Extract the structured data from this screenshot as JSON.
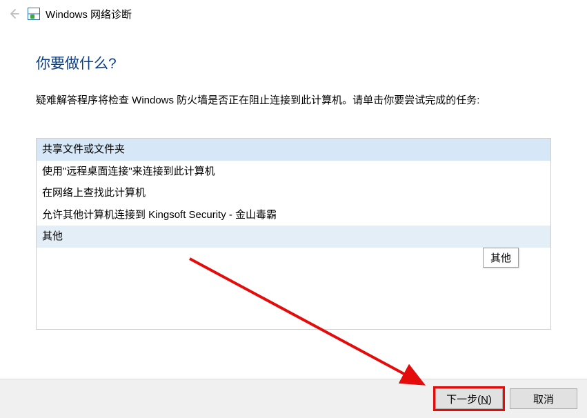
{
  "header": {
    "title": "Windows 网络诊断"
  },
  "main": {
    "heading": "你要做什么?",
    "description": "疑难解答程序将检查 Windows 防火墙是否正在阻止连接到此计算机。请单击你要尝试完成的任务:"
  },
  "options": {
    "items": [
      "共享文件或文件夹",
      "使用\"远程桌面连接\"来连接到此计算机",
      "在网络上查找此计算机",
      "允许其他计算机连接到 Kingsoft Security - 金山毒霸",
      "其他"
    ],
    "selected_index": 0,
    "tooltip": "其他"
  },
  "footer": {
    "next_label": "下一步(",
    "next_mnemonic": "N",
    "next_label_tail": ")",
    "cancel_label": "取消"
  }
}
